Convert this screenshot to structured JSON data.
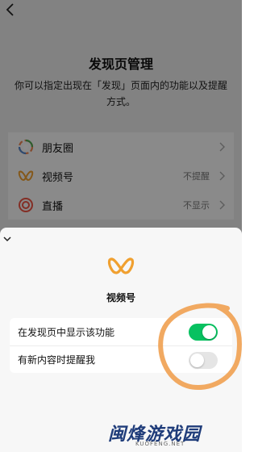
{
  "background_page": {
    "title": "发现页管理",
    "description": "你可以指定出现在「发现」页面内的功能以及提醒方式。",
    "items": [
      {
        "icon": "moments-icon",
        "label": "朋友圈",
        "value": ""
      },
      {
        "icon": "channels-icon",
        "label": "视频号",
        "value": "不提醒"
      },
      {
        "icon": "live-icon",
        "label": "直播",
        "value": "不显示"
      }
    ]
  },
  "sheet": {
    "icon": "channels-logo-icon",
    "title": "视频号",
    "options": [
      {
        "label": "在发现页中显示该功能",
        "enabled": true
      },
      {
        "label": "有新内容时提醒我",
        "enabled": false
      }
    ]
  },
  "watermark": {
    "text": "闽烽游戏园",
    "sub": "KUOFENG.NET"
  },
  "colors": {
    "toggle_on": "#07c160",
    "toggle_off": "#e5e5e5",
    "annotation": "#f0a050",
    "channels": "#f0a030"
  }
}
